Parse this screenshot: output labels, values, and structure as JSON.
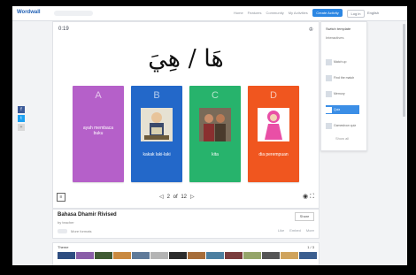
{
  "topbar": {
    "logo": "Wordwall",
    "nav": [
      "Home",
      "Features",
      "Community",
      "My Activities"
    ],
    "create_label": "Create Activity",
    "login_label": "Log in",
    "language": "English"
  },
  "social": [
    "f",
    "t",
    "+"
  ],
  "activity": {
    "timer": "0:19",
    "score_icon": "trophy",
    "prompt": "هَا / هِيَ",
    "cards": [
      {
        "letter": "A",
        "text": "ayah membaca buku",
        "color": "#b560c9",
        "has_image": false
      },
      {
        "letter": "B",
        "text": "kakak laki-laki",
        "color": "#2368c9",
        "has_image": true
      },
      {
        "letter": "C",
        "text": "kita",
        "color": "#27b36c",
        "has_image": true
      },
      {
        "letter": "D",
        "text": "dia perempuan",
        "color": "#f0561f",
        "has_image": true
      }
    ],
    "pager": {
      "prev": "◁",
      "current": "2",
      "total": "12",
      "next": "▷"
    },
    "tools": [
      "◉",
      "⛶"
    ]
  },
  "info": {
    "title": "Bahasa Dhamir Rivised",
    "author": "by teacher",
    "share_label": "Share",
    "meta": [
      "Like",
      "Embed",
      "More"
    ],
    "more_label": "More formats"
  },
  "themes": {
    "label": "Theme",
    "page": "1 / 3",
    "thumb_colors": [
      "#2e4d80",
      "#8a5ea8",
      "#405a33",
      "#c98940",
      "#5f7a99",
      "#b4b4b4",
      "#2c2c2c",
      "#a66d3a",
      "#4c7fa0",
      "#7a3d3d",
      "#95a56a",
      "#555",
      "#cfa35c",
      "#3b5e8f"
    ]
  },
  "panel": {
    "title": "Switch template",
    "subtitle": "Interactives",
    "items": [
      "Match up",
      "Find the match",
      "Memory",
      "Quiz",
      "Gameshow quiz"
    ],
    "active_index": 3,
    "more_label": "Show all"
  }
}
